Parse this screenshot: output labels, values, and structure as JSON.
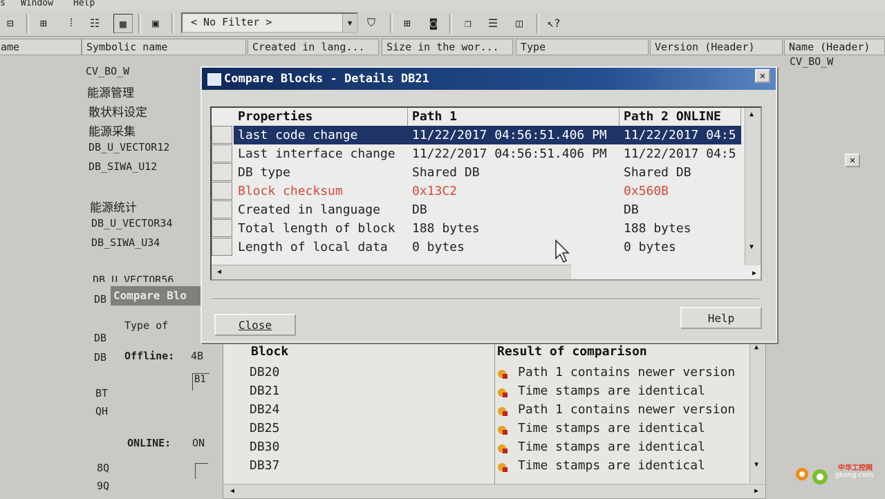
{
  "menu": {
    "item1": "s",
    "window": "Window",
    "help": "Help"
  },
  "toolbar": {
    "filter_value": "< No Filter >"
  },
  "columns": {
    "name": "ame",
    "symbolic": "Symbolic name",
    "created_in": "Created in lang...",
    "size": "Size in the wor...",
    "type": "Type",
    "version": "Version (Header)",
    "name_header": "Name (Header)"
  },
  "background": {
    "rows": [
      "CV_BO_W",
      "能源管理",
      "散状料设定",
      "能源采集",
      "DB_U_VECTOR12",
      "DB_SIWA_U12",
      "能源统计",
      "DB_U_VECTOR34",
      "DB_SIWA_U34",
      "DB_U_VECTOR56"
    ],
    "name_header_value": "CV_BO_W",
    "left_prefix": [
      "DB",
      "DB",
      "DB",
      "DB",
      "BT",
      "QH",
      "8Q",
      "9Q"
    ],
    "behind_title": "Compare Blo",
    "type_of": "Type of",
    "offline_label": "Offline:",
    "offline_value": "4B",
    "b1": "B1",
    "online_label": "ONLINE:",
    "online_value": "ON"
  },
  "dialog": {
    "title": "Compare Blocks - Details DB21",
    "headers": {
      "properties": "Properties",
      "path1": "Path 1",
      "path2": "Path 2 ONLINE"
    },
    "rows": [
      {
        "property": "last code change",
        "path1": "11/22/2017 04:56:51.406 PM",
        "path2": "11/22/2017 04:5",
        "selected": true,
        "diff": false
      },
      {
        "property": "Last interface change",
        "path1": "11/22/2017 04:56:51.406 PM",
        "path2": "11/22/2017 04:5",
        "selected": false,
        "diff": false
      },
      {
        "property": "DB type",
        "path1": "Shared DB",
        "path2": "Shared DB",
        "selected": false,
        "diff": false
      },
      {
        "property": "Block checksum",
        "path1": "0x13C2",
        "path2": "0x560B",
        "selected": false,
        "diff": true
      },
      {
        "property": "Created in language",
        "path1": "DB",
        "path2": "DB",
        "selected": false,
        "diff": false
      },
      {
        "property": "Total length of block",
        "path1": "188 bytes",
        "path2": "188 bytes",
        "selected": false,
        "diff": false
      },
      {
        "property": "Length of local data",
        "path1": "0 bytes",
        "path2": "0 bytes",
        "selected": false,
        "diff": false
      }
    ],
    "close_label": "Close",
    "help_label": "Help"
  },
  "comparison": {
    "headers": {
      "block": "Block",
      "result": "Result of comparison"
    },
    "rows": [
      {
        "block": "DB20",
        "result": "Path 1  contains newer version"
      },
      {
        "block": "DB21",
        "result": "Time stamps are identical"
      },
      {
        "block": "DB24",
        "result": "Path 1  contains newer version"
      },
      {
        "block": "DB25",
        "result": "Time stamps are identical"
      },
      {
        "block": "DB30",
        "result": "Time stamps are identical"
      },
      {
        "block": "DB37",
        "result": "Time stamps are identical"
      }
    ]
  },
  "watermark": {
    "site": "中华工控网",
    "domain": "gkong.com"
  },
  "colors": {
    "selection": "#1e3366",
    "diff_text": "#d24a3e",
    "title_gradient_start": "#102a5c",
    "warn_icon": "#e8a31c"
  }
}
